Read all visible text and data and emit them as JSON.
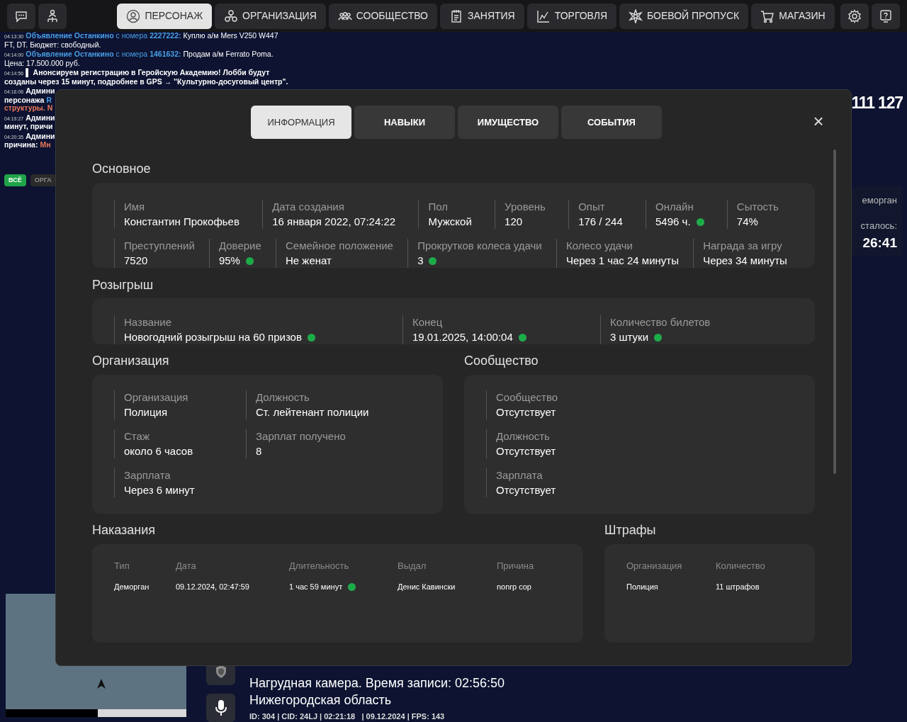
{
  "nav_tabs": [
    {
      "label": "ПЕРСОНАЖ",
      "selected": true
    },
    {
      "label": "ОРГАНИЗАЦИЯ",
      "selected": false
    },
    {
      "label": "СООБЩЕСТВО",
      "selected": false
    },
    {
      "label": "ЗАНЯТИЯ",
      "selected": false
    },
    {
      "label": "ТОРГОВЛЯ",
      "selected": false
    },
    {
      "label": "БОЕВОЙ ПРОПУСК",
      "selected": false
    },
    {
      "label": "МАГАЗИН",
      "selected": false
    }
  ],
  "chat": [
    {
      "lines": [
        [
          {
            "kind": "time",
            "text": "04:13:30"
          },
          {
            "kind": "link-bold",
            "text": "Объявление Останкино"
          },
          {
            "kind": "link",
            "text": "с номера"
          },
          {
            "kind": "link-bold",
            "text": "2227222:"
          },
          {
            "kind": "plain",
            "text": "Куплю а/м Mers V250 W447"
          }
        ],
        [
          {
            "kind": "plain",
            "text": "FT, DT. Бюджет: свободный."
          }
        ]
      ]
    },
    {
      "lines": [
        [
          {
            "kind": "time",
            "text": "04:14:00"
          },
          {
            "kind": "link-bold",
            "text": "Объявление Останкино"
          },
          {
            "kind": "link",
            "text": "с номера"
          },
          {
            "kind": "link-bold",
            "text": "1461632:"
          },
          {
            "kind": "plain",
            "text": "Продам а/м Ferrato Poma."
          }
        ],
        [
          {
            "kind": "plain",
            "text": "Цена: 17.500.000 руб."
          }
        ]
      ]
    },
    {
      "lines": [
        [
          {
            "kind": "time",
            "text": "04:14:56"
          },
          {
            "kind": "bold",
            "text": "▌ Анонсируем регистрацию в Геройскую Академию! Лобби будут"
          }
        ],
        [
          {
            "kind": "bold",
            "text": "созданы через 15 минут, подробнее в GPS → \"Культурно-досуговый центр\"."
          }
        ]
      ]
    },
    {
      "lines": [
        [
          {
            "kind": "time",
            "text": "04:16:06"
          },
          {
            "kind": "bold",
            "text": "Админи"
          }
        ],
        [
          {
            "kind": "bold",
            "text": "персонажа"
          },
          {
            "kind": "link-bold",
            "text": "R"
          }
        ],
        [
          {
            "kind": "alert",
            "text": "структуры. N"
          }
        ]
      ]
    },
    {
      "lines": [
        [
          {
            "kind": "time",
            "text": "04:19:27"
          },
          {
            "kind": "bold",
            "text": "Админи"
          }
        ],
        [
          {
            "kind": "bold",
            "text": "минут, причи"
          }
        ]
      ]
    },
    {
      "lines": [
        [
          {
            "kind": "time",
            "text": "04:20:35"
          },
          {
            "kind": "bold",
            "text": "Админи"
          }
        ],
        [
          {
            "kind": "bold",
            "text": "причина:"
          },
          {
            "kind": "alert",
            "text": "Мн"
          }
        ]
      ]
    }
  ],
  "chat_filters": [
    {
      "label": "ВСЁ",
      "selected": true
    },
    {
      "label": "ОРГА",
      "selected": false
    }
  ],
  "balance": "111 127",
  "side_panel": {
    "status": "еморган",
    "remaining_label": "сталось:",
    "remaining": "26:41"
  },
  "bodycam": {
    "title": "Нагрудная камера. Время записи: 02:56:50",
    "region": "Нижегородская область",
    "info": "ID: 304 | CID: 24LJ | 02:21:18   | 09.12.2024 | FPS: 143"
  },
  "modal": {
    "tabs": [
      {
        "label": "ИНФОРМАЦИЯ",
        "selected": true
      },
      {
        "label": "НАВЫКИ",
        "selected": false
      },
      {
        "label": "ИМУЩЕСТВО",
        "selected": false
      },
      {
        "label": "СОБЫТИЯ",
        "selected": false
      }
    ],
    "close": "×",
    "main": {
      "title": "Основное",
      "rows": [
        {
          "fields": [
            {
              "label": "Имя",
              "value": "Константин Прокофьев",
              "hint": false
            },
            {
              "label": "Дата создания",
              "value": "16 января 2022, 07:24:22",
              "hint": false
            },
            {
              "label": "Пол",
              "value": "Мужской",
              "hint": false
            },
            {
              "label": "Уровень",
              "value": "120",
              "hint": false
            },
            {
              "label": "Опыт",
              "value": "176 / 244",
              "hint": false
            },
            {
              "label": "Онлайн",
              "value": "5496 ч.",
              "hint": true
            },
            {
              "label": "Сытость",
              "value": "74%",
              "hint": false
            }
          ]
        },
        {
          "fields": [
            {
              "label": "Преступлений",
              "value": "7520",
              "hint": false
            },
            {
              "label": "Доверие",
              "value": "95%",
              "hint": true
            },
            {
              "label": "Семейное положение",
              "value": "Не женат",
              "hint": false
            },
            {
              "label": "Прокрутков колеса удачи",
              "value": "3",
              "hint": true
            },
            {
              "label": "Колесо удачи",
              "value": "Через 1 час 24 минуты",
              "hint": false
            },
            {
              "label": "Награда за игру",
              "value": "Через 34 минуты",
              "hint": false
            }
          ]
        }
      ]
    },
    "raffle": {
      "title": "Розыгрыш",
      "fields": [
        {
          "label": "Название",
          "value": "Новогодний розыгрыш на 60 призов",
          "hint": true
        },
        {
          "label": "Конец",
          "value": "19.01.2025, 14:00:04",
          "hint": true
        },
        {
          "label": "Количество билетов",
          "value": "3 штуки",
          "hint": true
        }
      ]
    },
    "organization": {
      "title": "Организация",
      "fields": [
        {
          "label": "Организация",
          "value": "Полиция"
        },
        {
          "label": "Должность",
          "value": "Ст. лейтенант полиции"
        },
        {
          "label": "Стаж",
          "value": "около 6 часов"
        },
        {
          "label": "Зарплат получено",
          "value": "8"
        },
        {
          "label": "Зарплата",
          "value": "Через 6 минут"
        }
      ]
    },
    "community": {
      "title": "Сообщество",
      "fields": [
        {
          "label": "Сообщество",
          "value": "Отсутствует"
        },
        {
          "label": "Должность",
          "value": "Отсутствует"
        },
        {
          "label": "Зарплата",
          "value": "Отсутствует"
        }
      ]
    },
    "punishments": {
      "title": "Наказания",
      "columns": [
        "Тип",
        "Дата",
        "Длительность",
        "Выдал",
        "Причина"
      ],
      "rows": [
        [
          {
            "text": "Деморган",
            "hint": false
          },
          {
            "text": "09.12.2024, 02:47:59",
            "hint": false
          },
          {
            "text": "1 час 59 минут",
            "hint": true
          },
          {
            "text": "Денис Кавински",
            "hint": false
          },
          {
            "text": "nonrp cop",
            "hint": false
          }
        ]
      ]
    },
    "fines": {
      "title": "Штрафы",
      "columns": [
        "Организация",
        "Количество"
      ],
      "rows": [
        [
          "Полиция",
          "11 штрафов"
        ]
      ]
    }
  }
}
